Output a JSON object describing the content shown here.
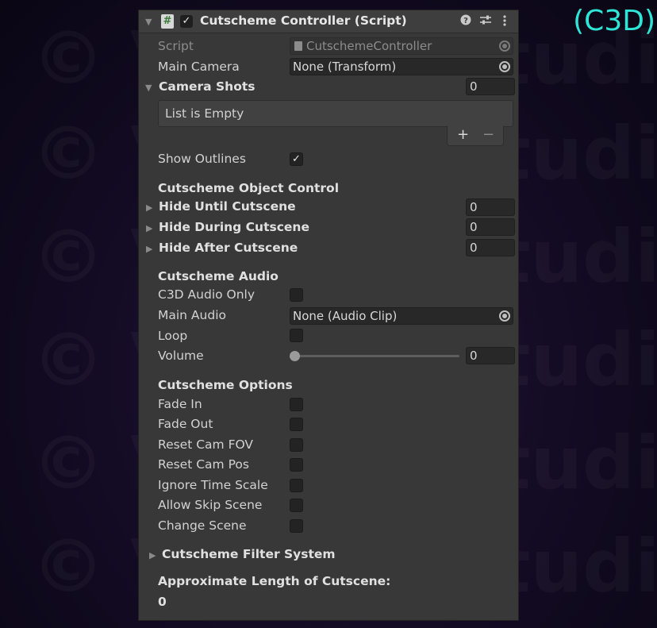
{
  "corner_tag": "(C3D)",
  "watermark": "© Vladsir Studio",
  "component": {
    "title": "Cutscheme Controller (Script)",
    "enabled_check": "✓",
    "header_icons": [
      "help-icon",
      "preset-icon",
      "kebab-menu-icon"
    ]
  },
  "script": {
    "label": "Script",
    "value": "CutschemeController"
  },
  "main_camera": {
    "label": "Main Camera",
    "value": "None (Transform)"
  },
  "camera_shots": {
    "label": "Camera Shots",
    "count": "0",
    "empty_text": "List is Empty",
    "add_label": "+",
    "remove_label": "−"
  },
  "show_outlines": {
    "label": "Show Outlines",
    "checked": "✓"
  },
  "object_control": {
    "heading": "Cutscheme Object Control",
    "items": [
      {
        "label": "Hide Until Cutscene",
        "count": "0"
      },
      {
        "label": "Hide During Cutscene",
        "count": "0"
      },
      {
        "label": "Hide After Cutscene",
        "count": "0"
      }
    ]
  },
  "audio": {
    "heading": "Cutscheme Audio",
    "c3d_only_label": "C3D Audio Only",
    "main_audio_label": "Main Audio",
    "main_audio_value": "None (Audio Clip)",
    "loop_label": "Loop",
    "volume_label": "Volume",
    "volume_value": "0",
    "volume_level": 0
  },
  "options": {
    "heading": "Cutscheme Options",
    "items": [
      {
        "label": "Fade In"
      },
      {
        "label": "Fade Out"
      },
      {
        "label": "Reset Cam FOV"
      },
      {
        "label": "Reset Cam Pos"
      },
      {
        "label": "Ignore Time Scale"
      },
      {
        "label": "Allow Skip Scene"
      },
      {
        "label": "Change Scene"
      }
    ]
  },
  "filter_system": {
    "label": "Cutscheme Filter System"
  },
  "length": {
    "label": "Approximate Length of Cutscene:",
    "value": "0"
  }
}
